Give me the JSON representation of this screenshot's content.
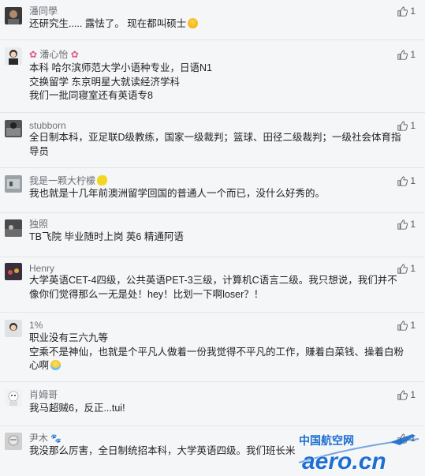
{
  "comments": [
    {
      "user": "潘同學",
      "lines": [
        "还研究生..... 露怯了。 现在都叫硕士"
      ],
      "likes": "1",
      "avatar_icon": "user-photo-icon",
      "emoji": "grin"
    },
    {
      "user": "潘心怡",
      "lines": [
        "本科 哈尔滨师范大学小语种专业，日语N1",
        "交换留学 东京明星大就读经济学科",
        "我们一批同寝室还有英语专8"
      ],
      "likes": "1",
      "avatar_icon": "user-photo-icon"
    },
    {
      "user": "stubborn",
      "lines": [
        "全日制本科，亚足联D级教练，国家一级裁判；篮球、田径二级裁判；一级社会体育指导员"
      ],
      "likes": "1",
      "avatar_icon": "user-photo-icon"
    },
    {
      "user": "我是一颗大柠檬",
      "lines": [
        "我也就是十几年前澳洲留学回国的普通人一个而已，没什么好秀的。"
      ],
      "likes": "1",
      "avatar_icon": "user-photo-icon"
    },
    {
      "user": "独照",
      "lines": [
        "TB飞院 毕业随时上岗 英6 精通阿语"
      ],
      "likes": "1",
      "avatar_icon": "user-photo-icon"
    },
    {
      "user": "Henry",
      "lines": [
        "大学英语CET-4四级，公共英语PET-3三级，计算机C语言二级。我只想说，我们并不像你们觉得那么一无是处！hey！比划一下啊loser？！"
      ],
      "likes": "1",
      "avatar_icon": "user-photo-icon"
    },
    {
      "user": "1%",
      "lines": [
        "职业没有三六九等",
        "空乘不是神仙，也就是个平凡人做着一份我觉得不平凡的工作，赚着白菜钱、操着白粉心啊"
      ],
      "likes": "1",
      "avatar_icon": "user-photo-icon",
      "emoji": "tears"
    },
    {
      "user": "肖姆哥",
      "lines": [
        "我马超贼6，反正...tui!"
      ],
      "likes": "1",
      "avatar_icon": "user-photo-icon"
    },
    {
      "user": "尹木",
      "lines": [
        "我没那么厉害，全日制统招本科，大学英语四级。我们班长米"
      ],
      "likes": "1",
      "avatar_icon": "user-photo-icon"
    }
  ],
  "watermark": {
    "cn": "中国航空网",
    "en": "aero.cn"
  },
  "colors": {
    "like": "#555555",
    "username": "#6b6f75",
    "watermark_blue": "#1e6fd0"
  }
}
